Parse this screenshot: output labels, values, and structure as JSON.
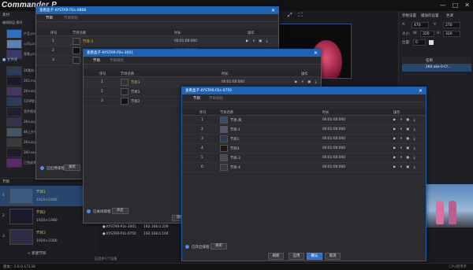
{
  "app": {
    "brand_a": "Commander",
    "brand_b": "P",
    "version": "版本：2.6.0.17138",
    "status_right": "CPU使用率",
    "min": "—",
    "max": "□",
    "close": "✕"
  },
  "left": {
    "section1": "素材",
    "section2": "编辑图层-素材",
    "folder": "文件夹",
    "items": [
      {
        "label": "产品.png",
        "color": "#2d6fc2"
      },
      {
        "label": "公司.png",
        "color": "#5b7fb6"
      },
      {
        "label": "视频.png",
        "color": "#3a3a6e"
      },
      {
        "label": "2K素材.mp4",
        "color": "#2c3c58"
      },
      {
        "label": "2K1.mp4",
        "color": "#1a1a2c"
      },
      {
        "label": "2K-lunpo.mp4",
        "color": "#433860"
      },
      {
        "label": "720P素材.mp4",
        "color": "#2b3b5b"
      },
      {
        "label": "宣传视频.mp4",
        "color": "#1f1f2f"
      },
      {
        "label": "2K-lunpo.mp4",
        "color": "#3a2f4f"
      },
      {
        "label": "4K上升镜.mp4",
        "color": "#445566"
      },
      {
        "label": "2K-lunpo.mp4",
        "color": "#3a3a3a"
      },
      {
        "label": "2K0-ake.mp4",
        "color": "#1c1c2c"
      },
      {
        "label": "已完成素材.mp4",
        "color": "#5a2a6e"
      }
    ]
  },
  "programs": {
    "section": "节目",
    "items": [
      {
        "num": "1",
        "name": "节目1",
        "res": "1920×1080",
        "thumb": "#3d5a80"
      },
      {
        "num": "2",
        "name": "节目2",
        "res": "1920×1080",
        "thumb": "#1a1a2a"
      },
      {
        "num": "3",
        "name": "节目3",
        "res": "1920×1080",
        "thumb": "#2c2e46"
      }
    ],
    "new_label": "+ 新建节目"
  },
  "right": {
    "tab1": "参数设置",
    "tab2": "播放的设置",
    "tab3": "色调",
    "x_label": "X:",
    "x_value": "470",
    "y_label": "Y:",
    "y_value": "270",
    "w_label": "大小:",
    "w_value": "W:",
    "w_num": "320",
    "h_label": "H:",
    "h_num": "320",
    "a_label": "位置:",
    "a_value": "0",
    "list_head": "名称",
    "list_item": "2K0-ake-0-Cf..."
  },
  "dialogs": [
    {
      "title": "查看盒子-KYSTAR-P2s-0868",
      "tab1": "节目",
      "tab2": "节目排程",
      "cols": [
        "序号",
        "节目名称",
        "时长",
        "操作"
      ],
      "rows": [
        {
          "num": "1",
          "name": "节目-3",
          "dur": "00:01:00:000",
          "thumb": "#2a2a2a",
          "hl": true
        },
        {
          "num": "2",
          "name": "节目2",
          "dur": "00:01:00:000",
          "thumb": "#111"
        },
        {
          "num": "3",
          "name": "节目1",
          "dur": "00:01:00:000",
          "thumb": "#223"
        }
      ],
      "radio": "已启用排程",
      "btn": "关闭"
    },
    {
      "title": "查看盒子-KYSTAR-P2s-3001",
      "tab1": "节目",
      "tab2": "节目排程",
      "cols": [
        "序号",
        "节目名称",
        "时长",
        "操作"
      ],
      "rows": [
        {
          "num": "1",
          "name": "节目3",
          "dur": "00:01:00:000",
          "thumb": "#333",
          "hl": true
        },
        {
          "num": "2",
          "name": "节目1",
          "dur": "00:01:00:000",
          "thumb": "#223"
        },
        {
          "num": "3",
          "name": "节目2",
          "dur": "00:01:00:000",
          "thumb": "#112"
        }
      ],
      "radio": "已关闭排程",
      "btn": "开启",
      "footer_btn": "添加"
    },
    {
      "title": "查看盒子-KYSTAR-P2s-0750",
      "tab1": "节目",
      "tab2": "节目排程",
      "cols": [
        "序号",
        "节目名称",
        "时长",
        "操作"
      ],
      "rows": [
        {
          "num": "1",
          "name": "节目-风",
          "dur": "00:01:00:000",
          "thumb": "#3a4a6a"
        },
        {
          "num": "2",
          "name": "节目-1",
          "dur": "00:01:00:000",
          "thumb": "#556"
        },
        {
          "num": "3",
          "name": "节目1",
          "dur": "00:01:00:000",
          "thumb": "#2a3a5a"
        },
        {
          "num": "4",
          "name": "节目4",
          "dur": "00:01:00:000",
          "thumb": "#1a1a1a"
        },
        {
          "num": "5",
          "name": "节目-3",
          "dur": "00:01:00:000",
          "thumb": "#4a4a5a"
        },
        {
          "num": "6",
          "name": "节目-4",
          "dur": "00:01:00:000",
          "thumb": "#3a3a3a"
        }
      ],
      "radio": "已开启排程",
      "btn": "关闭",
      "footer": [
        "刷新",
        "应用",
        "确认",
        "取消"
      ]
    }
  ],
  "ip_list": [
    {
      "name": "KYSTAR-P2s-3001",
      "ip": "192.168.0.209"
    },
    {
      "name": "KYSTAR-P2s-0750",
      "ip": "192.168.0.104"
    }
  ],
  "selected_text": "已选中1个设备",
  "ops_glyphs": "▶ ⏸ ▣ ⤓"
}
